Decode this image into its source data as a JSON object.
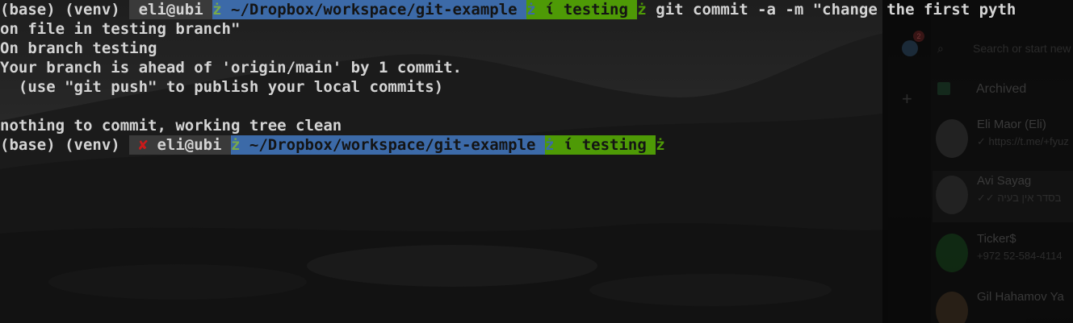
{
  "telegram": {
    "badge": "2",
    "search_placeholder": "Search or start new",
    "archived": "Archived",
    "chats": [
      {
        "name": "Eli Maor (Eli)",
        "message": "✓ https://t.me/+fyuz"
      },
      {
        "name": "Avi Sayag",
        "message": "✓✓ בסדר אין בעיה"
      },
      {
        "name": "Ticker$",
        "message": "+972 52-584-4114"
      },
      {
        "name": "Gil Hahamov Ya",
        "message": ""
      }
    ]
  },
  "terminal": {
    "prompt1": {
      "env": "(base) (venv) ",
      "status_glyph": "",
      "user": " eli@ubi ",
      "sep1": "ż",
      "path": " ~/Dropbox/workspace/git-example ",
      "sep2": "ż",
      "branch_glyph": " ί ",
      "branch": "testing ",
      "sep3": "ż",
      "command": " git commit -a -m \"change the first pyth"
    },
    "wrap": "on file in testing branch\"",
    "output": [
      "On branch testing",
      "Your branch is ahead of 'origin/main' by 1 commit.",
      "  (use \"git push\" to publish your local commits)",
      "",
      "nothing to commit, working tree clean"
    ],
    "prompt2": {
      "env": "(base) (venv) ",
      "status_glyph": " ✘",
      "user": " eli@ubi ",
      "sep1": "ż",
      "path": " ~/Dropbox/workspace/git-example ",
      "sep2": "ż",
      "branch_glyph": " ί ",
      "branch": "testing ",
      "sep3": "ż"
    }
  }
}
